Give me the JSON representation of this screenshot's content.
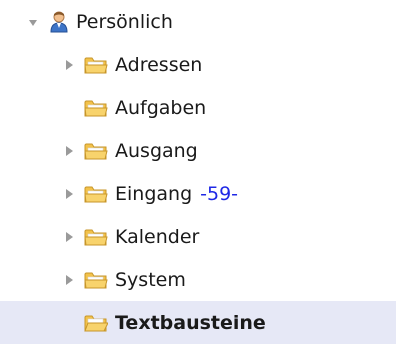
{
  "tree": {
    "root": {
      "label": "Persönlich",
      "icon": "user-icon",
      "expanded": true
    },
    "items": [
      {
        "label": "Adressen",
        "has_children": true,
        "count": "",
        "selected": false,
        "icon": "folder-icon"
      },
      {
        "label": "Aufgaben",
        "has_children": false,
        "count": "",
        "selected": false,
        "icon": "folder-icon"
      },
      {
        "label": "Ausgang",
        "has_children": true,
        "count": "",
        "selected": false,
        "icon": "folder-icon"
      },
      {
        "label": "Eingang",
        "has_children": true,
        "count": "-59-",
        "selected": false,
        "icon": "folder-icon"
      },
      {
        "label": "Kalender",
        "has_children": true,
        "count": "",
        "selected": false,
        "icon": "folder-icon"
      },
      {
        "label": "System",
        "has_children": true,
        "count": "",
        "selected": false,
        "icon": "folder-icon"
      },
      {
        "label": "Textbausteine",
        "has_children": false,
        "count": "",
        "selected": true,
        "icon": "folder-open-icon"
      }
    ]
  },
  "colors": {
    "selection_bg": "#e6e8f6",
    "count_text": "#1f28e6",
    "toggle_arrow": "#9a9a9a",
    "folder_yellow": "#f3c24a"
  }
}
